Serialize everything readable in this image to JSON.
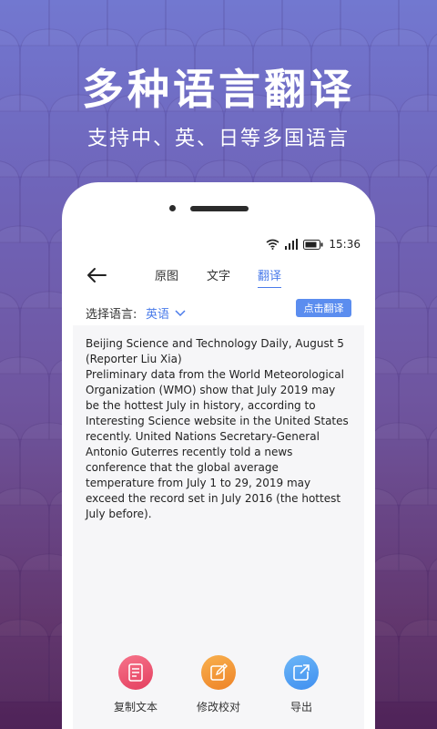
{
  "banner": {
    "title": "多种语言翻译",
    "subtitle": "支持中、英、日等多国语言"
  },
  "status_bar": {
    "time": "15:36",
    "icons": [
      "wifi-icon",
      "signal-icon",
      "battery-icon"
    ]
  },
  "nav": {
    "back_icon": "arrow-left-icon",
    "tabs": [
      {
        "label": "原图"
      },
      {
        "label": "文字"
      },
      {
        "label": "翻译"
      }
    ],
    "active_tab": "翻译"
  },
  "language": {
    "label": "选择语言:",
    "selected": "英语",
    "translate_button": "点击翻译"
  },
  "translation_text": "Beijing Science and Technology Daily, August 5 (Reporter Liu Xia)\nPreliminary data from the World Meteorological Organization (WMO) show that July 2019 may be the hottest July in history, according to Interesting Science website in the United States recently. United Nations Secretary-General Antonio Guterres recently told a news conference that the global average temperature from July 1 to 29, 2019 may exceed the record set in July 2016 (the hottest July before).",
  "actions": [
    {
      "label": "复制文本",
      "icon": "document-icon",
      "color": "#ec4f6c"
    },
    {
      "label": "修改校对",
      "icon": "edit-icon",
      "color": "#f3963a"
    },
    {
      "label": "导出",
      "icon": "export-icon",
      "color": "#4f9df2"
    }
  ],
  "colors": {
    "accent": "#4a7bea",
    "button": "#5b8def"
  }
}
